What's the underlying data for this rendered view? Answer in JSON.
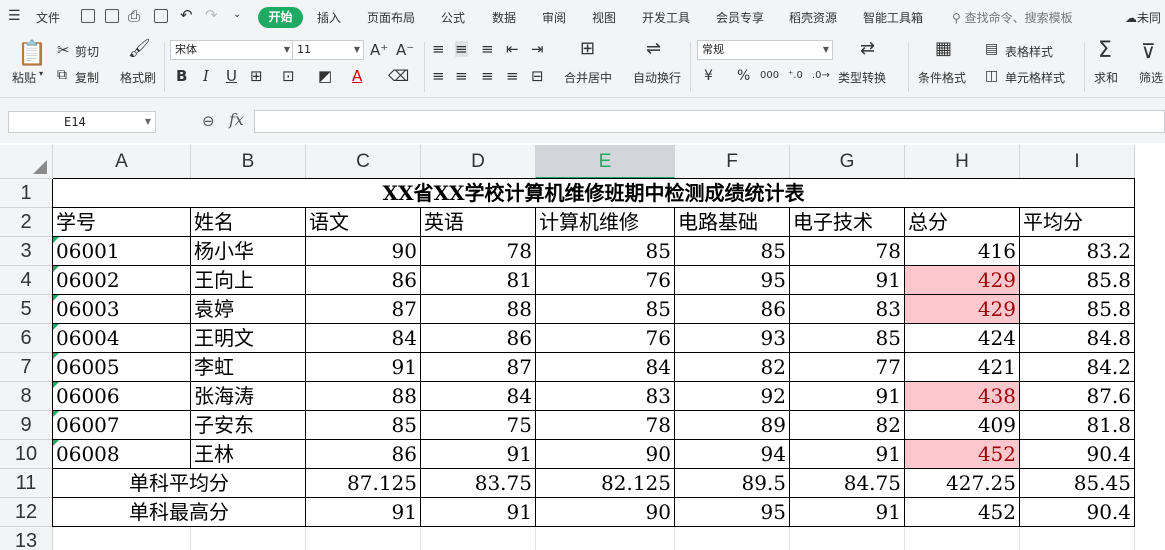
{
  "menu": {
    "file": "文件",
    "tabs": [
      "开始",
      "插入",
      "页面布局",
      "公式",
      "数据",
      "审阅",
      "视图",
      "开发工具",
      "会员专享",
      "稻壳资源",
      "智能工具箱"
    ],
    "search_placeholder": "查找命令、搜索模板",
    "cloud": "未同"
  },
  "ribbon": {
    "paste": "粘贴",
    "cut": "剪切",
    "copy": "复制",
    "format_painter": "格式刷",
    "font_name": "宋体",
    "font_size": "11",
    "bold": "B",
    "italic": "I",
    "underline": "U",
    "merge_center": "合并居中",
    "wrap_text": "自动换行",
    "number_format": "常规",
    "currency": "¥",
    "percent": "%",
    "thousands": "000",
    "type_convert": "类型转换",
    "conditional_format": "条件格式",
    "table_style": "表格样式",
    "cell_style": "单元格样式",
    "sum": "求和",
    "filter": "筛选"
  },
  "formula_bar": {
    "cell_ref": "E14",
    "fx": "fx",
    "content": ""
  },
  "grid": {
    "selected_column": "E",
    "columns": [
      "A",
      "B",
      "C",
      "D",
      "E",
      "F",
      "G",
      "H",
      "I"
    ],
    "row_numbers": [
      "1",
      "2",
      "3",
      "4",
      "5",
      "6",
      "7",
      "8",
      "9",
      "10",
      "11",
      "12",
      "13"
    ],
    "title": "XX省XX学校计算机维修班期中检测成绩统计表",
    "headers": [
      "学号",
      "姓名",
      "语文",
      "英语",
      "计算机维修",
      "电路基础",
      "电子技术",
      "总分",
      "平均分"
    ],
    "records": [
      {
        "id": "06001",
        "name": "杨小华",
        "scores": [
          "90",
          "78",
          "85",
          "85",
          "78"
        ],
        "total": "416",
        "avg": "83.2",
        "total_highlight": false
      },
      {
        "id": "06002",
        "name": "王向上",
        "scores": [
          "86",
          "81",
          "76",
          "95",
          "91"
        ],
        "total": "429",
        "avg": "85.8",
        "total_highlight": true
      },
      {
        "id": "06003",
        "name": "袁婷",
        "scores": [
          "87",
          "88",
          "85",
          "86",
          "83"
        ],
        "total": "429",
        "avg": "85.8",
        "total_highlight": true
      },
      {
        "id": "06004",
        "name": "王明文",
        "scores": [
          "84",
          "86",
          "76",
          "93",
          "85"
        ],
        "total": "424",
        "avg": "84.8",
        "total_highlight": false
      },
      {
        "id": "06005",
        "name": "李虹",
        "scores": [
          "91",
          "87",
          "84",
          "82",
          "77"
        ],
        "total": "421",
        "avg": "84.2",
        "total_highlight": false
      },
      {
        "id": "06006",
        "name": "张海涛",
        "scores": [
          "88",
          "84",
          "83",
          "92",
          "91"
        ],
        "total": "438",
        "avg": "87.6",
        "total_highlight": true
      },
      {
        "id": "06007",
        "name": "子安东",
        "scores": [
          "85",
          "75",
          "78",
          "89",
          "82"
        ],
        "total": "409",
        "avg": "81.8",
        "total_highlight": false
      },
      {
        "id": "06008",
        "name": "王林",
        "scores": [
          "86",
          "91",
          "90",
          "94",
          "91"
        ],
        "total": "452",
        "avg": "90.4",
        "total_highlight": true
      }
    ],
    "summary": [
      {
        "label": "单科平均分",
        "values": [
          "87.125",
          "83.75",
          "82.125",
          "89.5",
          "84.75",
          "427.25",
          "85.45"
        ]
      },
      {
        "label": "单科最高分",
        "values": [
          "91",
          "91",
          "90",
          "95",
          "91",
          "452",
          "90.4"
        ]
      }
    ],
    "highlight_color": "#fdc7ce",
    "highlight_text_color": "#9c0006",
    "accent_color": "#1faa63"
  }
}
